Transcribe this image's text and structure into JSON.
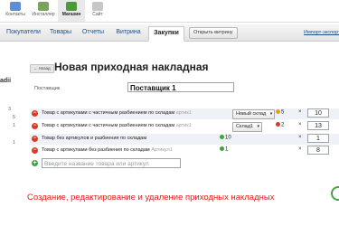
{
  "topbar": {
    "apps": [
      {
        "label": "Контакты",
        "icon": "contacts-icon",
        "color": "#5b8ed6"
      },
      {
        "label": "Инсталлер",
        "icon": "installer-icon",
        "color": "#7aa35b"
      },
      {
        "label": "Магазин",
        "icon": "shop-icon",
        "color": "#4c9a3a"
      },
      {
        "label": "Сайт",
        "icon": "site-icon",
        "color": "#c7c7c7"
      }
    ]
  },
  "tabs": {
    "items": [
      "Покупатели",
      "Товары",
      "Отчеты",
      "Витрина",
      "Закупки"
    ],
    "active": "Закупки",
    "open_showcase": "Открыть витрину",
    "import": "Импорт-экспорт"
  },
  "sidebar": {
    "label": "adii",
    "numbers": [
      "3",
      "5",
      "1",
      "1"
    ]
  },
  "page": {
    "back": "Назад",
    "title": "Новая приходная накладная",
    "supplier_label": "Поставщик",
    "supplier_value": "Поставщик 1"
  },
  "rows": [
    {
      "name": "Товар с артикулами с частичным разбиением по складам",
      "sku": "артик1",
      "warehouse": "Новый склад",
      "stock": "5",
      "stock_color": "#e0a21a",
      "qty": "10"
    },
    {
      "name": "Товар с артикулами с частичным разбиением по складам",
      "sku": "артик1",
      "warehouse": "Склад1",
      "stock": "2",
      "stock_color": "#d83a2c",
      "qty": "13"
    },
    {
      "name": "Товар без артикулов и разбиения по складам",
      "sku": "",
      "warehouse": "",
      "stock": "10",
      "stock_color": "#3aa53a",
      "qty": "1"
    },
    {
      "name": "Товар с артикулами без разбиения по складам",
      "sku": "Артикул1",
      "warehouse": "",
      "stock": "1",
      "stock_color": "#3aa53a",
      "qty": "8"
    }
  ],
  "add_placeholder": "Введите название товара или артикул",
  "caption": "Создание, редактирование и удаление приходных накладных",
  "colors": {
    "caption": "#e01b1b",
    "delete": "#d83a2c",
    "add": "#3aa53a"
  }
}
